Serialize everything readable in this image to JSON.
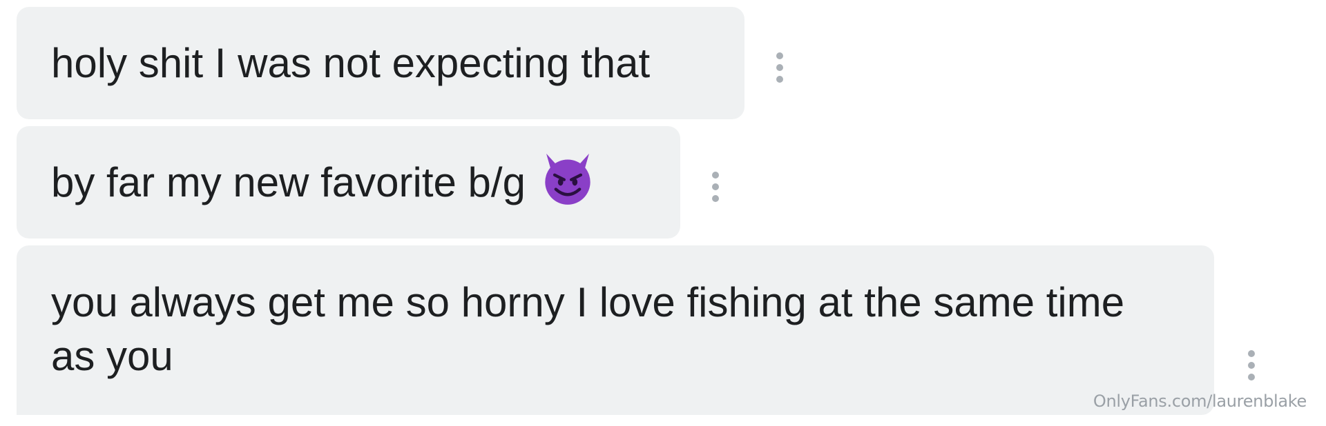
{
  "messages": [
    {
      "text": "holy shit I was not expecting that"
    },
    {
      "text": "by far my new favorite b/g",
      "emoji": "smiling-imp-emoji"
    },
    {
      "text": "you always get me so horny I love fishing at the same time as you"
    }
  ],
  "watermark": "OnlyFans.com/laurenblake",
  "colors": {
    "bubble_bg": "#eff1f2",
    "text": "#1d1f21",
    "kebab_dots": "#aab0b6",
    "watermark": "#9aa0a6",
    "emoji_purple": "#8a3fc7"
  }
}
